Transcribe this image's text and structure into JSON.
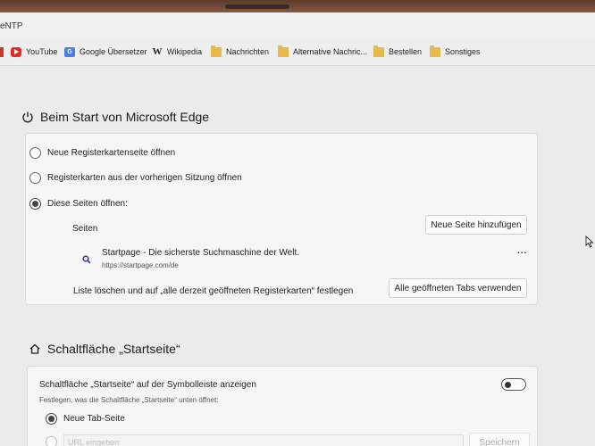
{
  "tab": {
    "title_fragment": "eNTP"
  },
  "bookmarks": [
    {
      "label": "YouTube",
      "icon": "youtube-icon"
    },
    {
      "label": "Google Übersetzer",
      "icon": "google-translate-icon"
    },
    {
      "label": "Wikipedia",
      "icon": "wikipedia-icon",
      "glyph": "W"
    },
    {
      "label": "Nachrichten",
      "icon": "folder-icon"
    },
    {
      "label": "Alternative Nachric...",
      "icon": "folder-icon"
    },
    {
      "label": "Bestellen",
      "icon": "folder-icon"
    },
    {
      "label": "Sonstiges",
      "icon": "folder-icon"
    }
  ],
  "startup": {
    "title": "Beim Start von Microsoft Edge",
    "options": [
      {
        "label": "Neue Registerkartenseite öffnen",
        "checked": false
      },
      {
        "label": "Registerkarten aus der vorherigen Sitzung öffnen",
        "checked": false
      },
      {
        "label": "Diese Seiten öffnen:",
        "checked": true
      }
    ],
    "pages_label": "Seiten",
    "add_page_button": "Neue Seite hinzufügen",
    "pages": [
      {
        "title": "Startpage - Die sicherste Suchmaschine der Welt.",
        "url": "https://startpage.com/de",
        "more": "..."
      }
    ],
    "clear_text": "Liste löschen und auf „alle derzeit geöffneten Registerkarten“ festlegen",
    "use_all_tabs_button": "Alle geöffneten Tabs verwenden"
  },
  "home_button": {
    "title": "Schaltfläche „Startseite“",
    "show_label": "Schaltfläche „Startseite“ auf der Symbolleiste anzeigen",
    "toggle_on": false,
    "sub_label": "Festlegen, was die Schaltfläche „Startseite“ unten öffnet:",
    "options": [
      {
        "label": "Neue Tab-Seite",
        "checked": true
      },
      {
        "label": "URL eingeben",
        "checked": false
      }
    ],
    "save_button": "Speichern"
  }
}
